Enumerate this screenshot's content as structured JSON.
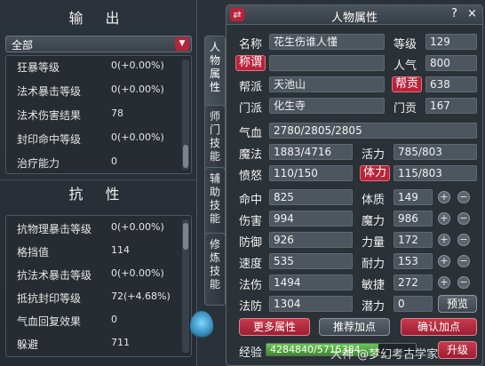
{
  "left_panel": {
    "output_title": "输 出",
    "filter_value": "全部",
    "output_stats": [
      {
        "label": "狂暴等级",
        "value": "0(+0.00%)"
      },
      {
        "label": "法术暴击等级",
        "value": "0(+0.00%)"
      },
      {
        "label": "法术伤害结果",
        "value": "78"
      },
      {
        "label": "封印命中等级",
        "value": "0(+0.00%)"
      },
      {
        "label": "治疗能力",
        "value": "0"
      }
    ],
    "resist_title": "抗 性",
    "resist_stats": [
      {
        "label": "抗物理暴击等级",
        "value": "0(+0.00%)"
      },
      {
        "label": "格挡值",
        "value": "114"
      },
      {
        "label": "抗法术暴击等级",
        "value": "0(+0.00%)"
      },
      {
        "label": "抵抗封印等级",
        "value": "72(+4.68%)"
      },
      {
        "label": "气血回复效果",
        "value": "0"
      },
      {
        "label": "躲避",
        "value": "711"
      }
    ]
  },
  "side_tabs": [
    "人物属性",
    "师门技能",
    "辅助技能",
    "修炼技能"
  ],
  "right_panel": {
    "title": "人物属性",
    "help": "?",
    "close": "×",
    "name_label": "名称",
    "name": "花生伤谁人懂",
    "level_label": "等级",
    "level": "129",
    "title_label": "称谓",
    "title_value": "",
    "popularity_label": "人气",
    "popularity": "800",
    "guild_label": "帮派",
    "guild": "天池山",
    "guild_contrib_label": "帮贡",
    "guild_contrib": "638",
    "sect_label": "门派",
    "sect": "化生寺",
    "sect_contrib_label": "门贡",
    "sect_contrib": "167",
    "hp_label": "气血",
    "hp": "2780/2805/2805",
    "mp_label": "魔法",
    "mp": "1883/4716",
    "vitality_label": "活力",
    "vitality": "785/803",
    "rage_label": "愤怒",
    "rage": "110/150",
    "stamina_label": "体力",
    "stamina": "115/803",
    "attrs": [
      {
        "label": "命中",
        "value": "825",
        "base_label": "体质",
        "base_value": "149"
      },
      {
        "label": "伤害",
        "value": "994",
        "base_label": "魔力",
        "base_value": "986"
      },
      {
        "label": "防御",
        "value": "926",
        "base_label": "力量",
        "base_value": "172"
      },
      {
        "label": "速度",
        "value": "535",
        "base_label": "耐力",
        "base_value": "153"
      },
      {
        "label": "法伤",
        "value": "1494",
        "base_label": "敏捷",
        "base_value": "272"
      }
    ],
    "mdef_label": "法防",
    "mdef": "1304",
    "potential_label": "潜力",
    "potential": "0",
    "preview_label": "预览",
    "more_attrs_label": "更多属性",
    "recommend_label": "推荐加点",
    "confirm_label": "确认加点",
    "exp_label": "经验",
    "exp_value": "4284840/5715384",
    "exp_fraction": 0.75,
    "upgrade_label": "升级",
    "plus": "+",
    "minus": "−"
  },
  "watermark": "大神 @梦幻考古学家",
  "colors": {
    "accent_red": "#b8243a",
    "panel_bg": "#2a3137",
    "field_bg": "#4d565f"
  }
}
